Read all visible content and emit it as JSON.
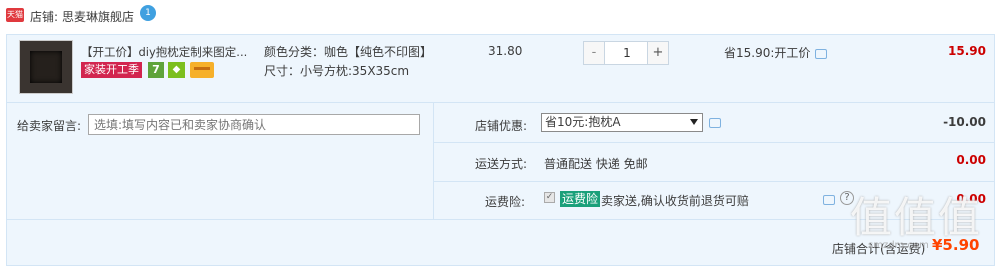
{
  "shop": {
    "tmall_badge": "天猫",
    "label": "店铺:",
    "name": "思麦琳旗舰店",
    "wangwang_icon": "1"
  },
  "item": {
    "title": "【开工价】diy抱枕定制来图定...",
    "promo_tag": "家装开工季",
    "badge_7": "7",
    "sku_color": "颜色分类：咖色【纯色不印图】",
    "sku_size": "尺寸：小号方枕:35X35cm",
    "unit_price": "31.80",
    "quantity": "1",
    "qty_minus": "-",
    "qty_plus": "+",
    "discount": "省15.90:开工价",
    "subtotal": "15.90"
  },
  "extras": {
    "message_label": "给卖家留言:",
    "message_placeholder": "选填:填写内容已和卖家协商确认",
    "coupon_label": "店铺优惠:",
    "coupon_selected": "省10元:抱枕A",
    "coupon_amount": "-10.00",
    "shipping_label": "运送方式:",
    "shipping_value": "普通配送 快递 免邮",
    "shipping_amount": "0.00",
    "insurance_label": "运费险:",
    "insurance_tag": "运费险",
    "insurance_text": "卖家送,确认收货前退货可赔",
    "insurance_amount": "0.00",
    "help_icon": "?"
  },
  "total": {
    "label": "店铺合计(含运费)",
    "amount": "¥5.90"
  },
  "watermark": {
    "glyphs": "值值值",
    "url": "smzdm.com"
  },
  "colors": {
    "accent_red": "#c00000",
    "total_orange": "#ff4400",
    "row_bg": "#eef6fd",
    "promo_pink": "#d2254f",
    "insurance_green": "#1aa07a"
  }
}
